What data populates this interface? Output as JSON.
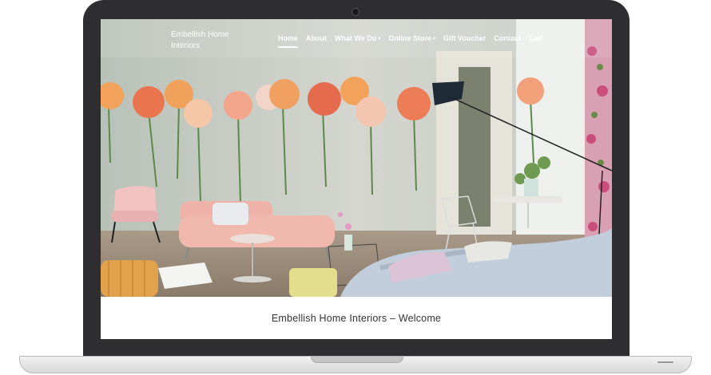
{
  "site": {
    "title": "Embellish Home Interiors"
  },
  "nav": {
    "items": [
      {
        "label": "Home",
        "active": true,
        "dropdown": false
      },
      {
        "label": "About",
        "active": false,
        "dropdown": false
      },
      {
        "label": "What We Do",
        "active": false,
        "dropdown": true
      },
      {
        "label": "Online Store",
        "active": false,
        "dropdown": true
      },
      {
        "label": "Gift Voucher",
        "active": false,
        "dropdown": false
      },
      {
        "label": "Contact",
        "active": false,
        "dropdown": false
      },
      {
        "label": "Cart",
        "active": false,
        "dropdown": false
      }
    ],
    "caret_glyph": "▾"
  },
  "welcome": {
    "heading": "Embellish Home Interiors – Welcome"
  },
  "colors": {
    "lid": "#2e2e30",
    "wall": "#c9cdc4",
    "sofa_pink": "#f0b9ad",
    "sofa_blue": "#b8c6d8"
  }
}
